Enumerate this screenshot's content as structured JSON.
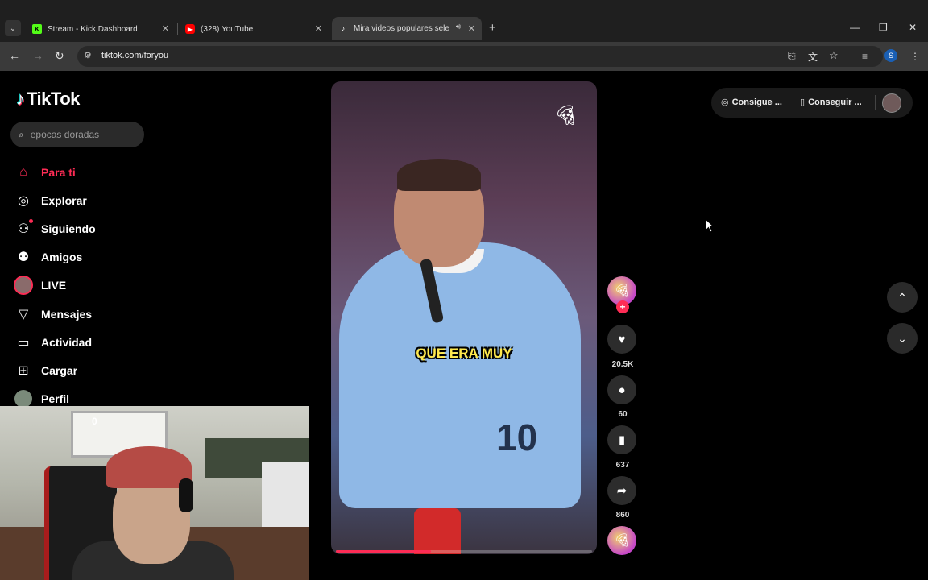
{
  "browser": {
    "tabs": [
      {
        "title": "Stream - Kick Dashboard",
        "icon": "kick-icon",
        "color": "#53fc18"
      },
      {
        "title": "(328) YouTube",
        "icon": "youtube-icon",
        "color": "#ff0000"
      },
      {
        "title": "Mira videos populares sele",
        "icon": "tiktok-icon",
        "color": "#ffffff"
      }
    ],
    "url": "tiktok.com/foryou",
    "profile_initial": "S"
  },
  "tiktok": {
    "logo_text": "TikTok",
    "search_placeholder": "epocas doradas",
    "nav": [
      {
        "label": "Para ti",
        "icon": "home-icon",
        "active": true
      },
      {
        "label": "Explorar",
        "icon": "compass-icon"
      },
      {
        "label": "Siguiendo",
        "icon": "following-icon"
      },
      {
        "label": "Amigos",
        "icon": "friends-icon"
      },
      {
        "label": "LIVE",
        "icon": "live-avatar-icon"
      },
      {
        "label": "Mensajes",
        "icon": "send-icon"
      },
      {
        "label": "Actividad",
        "icon": "activity-icon"
      },
      {
        "label": "Cargar",
        "icon": "upload-icon"
      },
      {
        "label": "Perfil",
        "icon": "profile-avatar-icon"
      }
    ],
    "header": {
      "coins_label": "Consigue ...",
      "app_label": "Conseguir ..."
    },
    "video": {
      "caption": "QUE ERA MUY",
      "progress_fraction": 0.37
    },
    "actions": {
      "likes": "20.5K",
      "comments": "60",
      "saves": "637",
      "shares": "860"
    },
    "accent_color": "#fe2c55"
  },
  "webcam": {
    "counter": "0"
  }
}
